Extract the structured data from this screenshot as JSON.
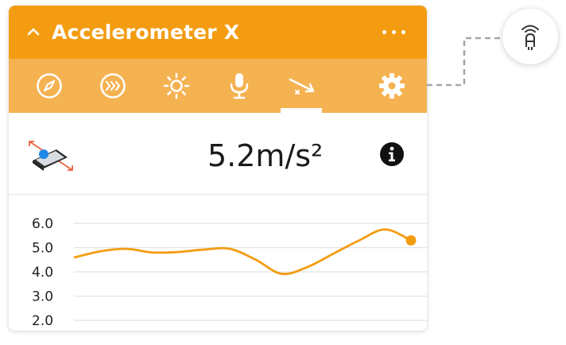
{
  "widget": {
    "title": "Accelerometer X",
    "accent_color": "#f39c12",
    "toolbar_color": "#f5b251"
  },
  "toolbar": {
    "tools": [
      {
        "icon": "compass-icon"
      },
      {
        "icon": "fast-forward-icon"
      },
      {
        "icon": "sun-icon"
      },
      {
        "icon": "microphone-icon"
      },
      {
        "icon": "acceleration-icon",
        "active": true
      },
      {
        "icon": "gear-icon"
      }
    ]
  },
  "sensor": {
    "icon": "phone-tilt-icon",
    "value": "5.2m/s²",
    "info_icon": "info-icon"
  },
  "chart_data": {
    "type": "line",
    "y_ticks": [
      "6.0",
      "5.0",
      "4.0",
      "3.0",
      "2.0"
    ],
    "ylim": [
      2.0,
      6.0
    ],
    "grid": true,
    "line_color": "#f39c12",
    "series": [
      {
        "x": [
          0,
          1,
          2,
          3,
          4,
          5,
          6,
          7,
          8,
          9,
          10,
          11,
          12,
          13
        ],
        "values": [
          4.6,
          4.85,
          4.95,
          4.8,
          4.82,
          4.92,
          4.95,
          4.5,
          3.92,
          4.2,
          4.75,
          5.3,
          5.75,
          5.3
        ]
      }
    ]
  },
  "bluetooth": {
    "icon": "bluetooth-sensor-icon",
    "connector_color": "#a3a8ad"
  }
}
